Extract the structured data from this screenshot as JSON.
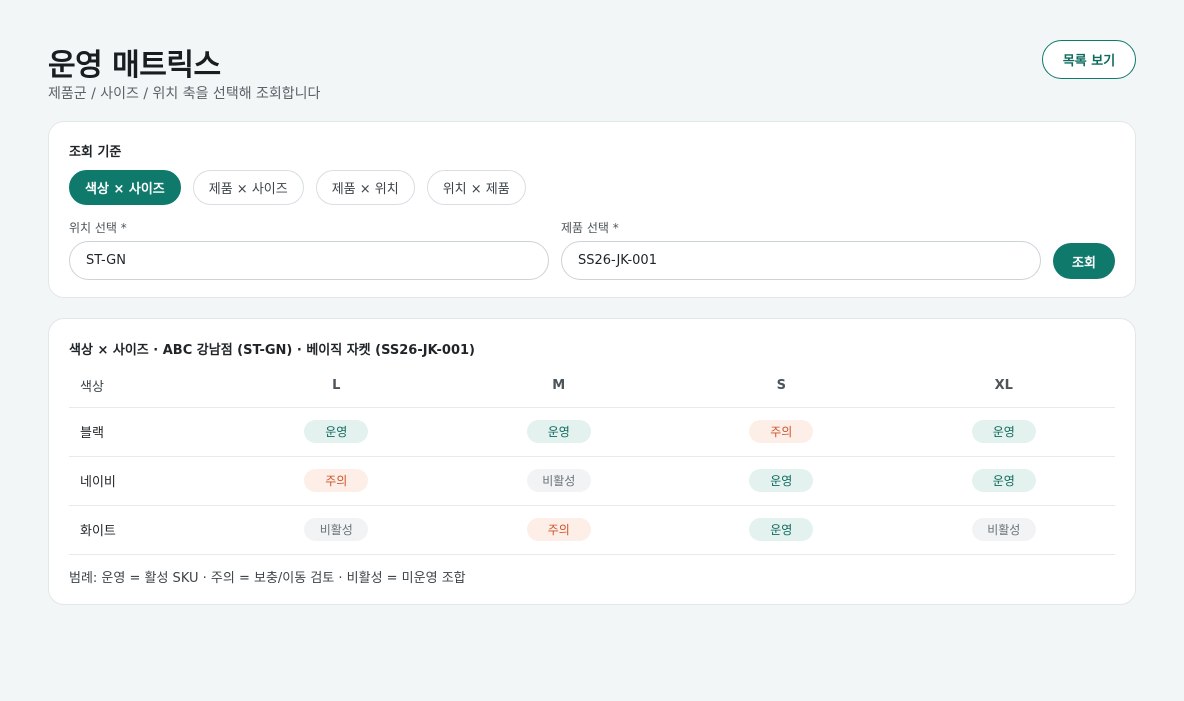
{
  "header": {
    "title": "운영 매트릭스",
    "subtitle": "제품군 / 사이즈 / 위치 축을 선택해 조회합니다",
    "list_button": "목록 보기"
  },
  "filter": {
    "label": "조회 기준",
    "chips": [
      "색상 × 사이즈",
      "제품 × 사이즈",
      "제품 × 위치",
      "위치 × 제품"
    ],
    "active_chip": 0,
    "location_label": "위치 선택 *",
    "location_value": "ST-GN",
    "product_label": "제품 선택 *",
    "product_value": "SS26-JK-001",
    "search_button": "조회"
  },
  "matrix": {
    "title": "색상 × 사이즈 · ABC 강남점 (ST-GN) · 베이직 자켓 (SS26-JK-001)",
    "row_header": "색상",
    "columns": [
      "L",
      "M",
      "S",
      "XL"
    ],
    "rows": [
      {
        "label": "블랙",
        "cells": [
          {
            "text": "운영",
            "status": "on"
          },
          {
            "text": "운영",
            "status": "on"
          },
          {
            "text": "주의",
            "status": "warn"
          },
          {
            "text": "운영",
            "status": "on"
          }
        ]
      },
      {
        "label": "네이비",
        "cells": [
          {
            "text": "주의",
            "status": "warn"
          },
          {
            "text": "비활성",
            "status": "off"
          },
          {
            "text": "운영",
            "status": "on"
          },
          {
            "text": "운영",
            "status": "on"
          }
        ]
      },
      {
        "label": "화이트",
        "cells": [
          {
            "text": "비활성",
            "status": "off"
          },
          {
            "text": "주의",
            "status": "warn"
          },
          {
            "text": "운영",
            "status": "on"
          },
          {
            "text": "비활성",
            "status": "off"
          }
        ]
      }
    ],
    "legend": "범례: 운영 = 활성 SKU · 주의 = 보충/이동 검토 · 비활성 = 미운영 조합"
  },
  "colors": {
    "accent": "#0f7a6c",
    "warn": "#d0532b",
    "background": "#f3f6f7"
  }
}
